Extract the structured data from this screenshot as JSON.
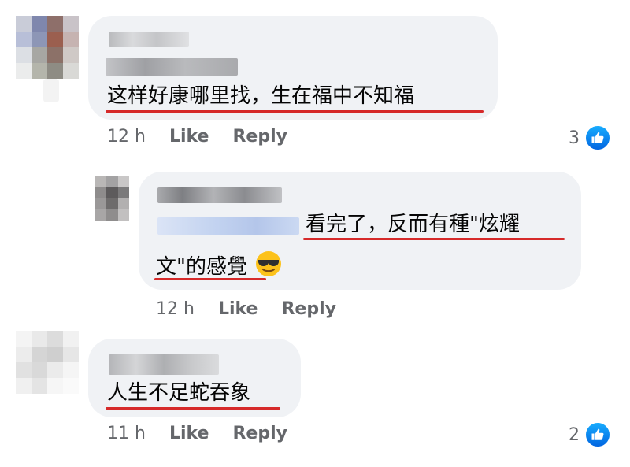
{
  "comments": [
    {
      "text": "这样好康哪里找，生在福中不知福",
      "time": "12 h",
      "like_label": "Like",
      "reply_label": "Reply",
      "reaction_count": "3",
      "reaction_icon": "thumbs-up-icon"
    },
    {
      "text_line1": "看完了，反而有種\"炫耀",
      "text_line2": "文\"的感覺",
      "emoji": "sunglasses-emoji",
      "time": "12 h",
      "like_label": "Like",
      "reply_label": "Reply"
    },
    {
      "text": "人生不足蛇吞象",
      "time": "11 h",
      "like_label": "Like",
      "reply_label": "Reply",
      "reaction_count": "2",
      "reaction_icon": "thumbs-up-icon"
    }
  ],
  "colors": {
    "bubble": "#f0f2f5",
    "meta_text": "#65676b",
    "underline": "#d62a2a",
    "like_blue": "#1877f2"
  }
}
